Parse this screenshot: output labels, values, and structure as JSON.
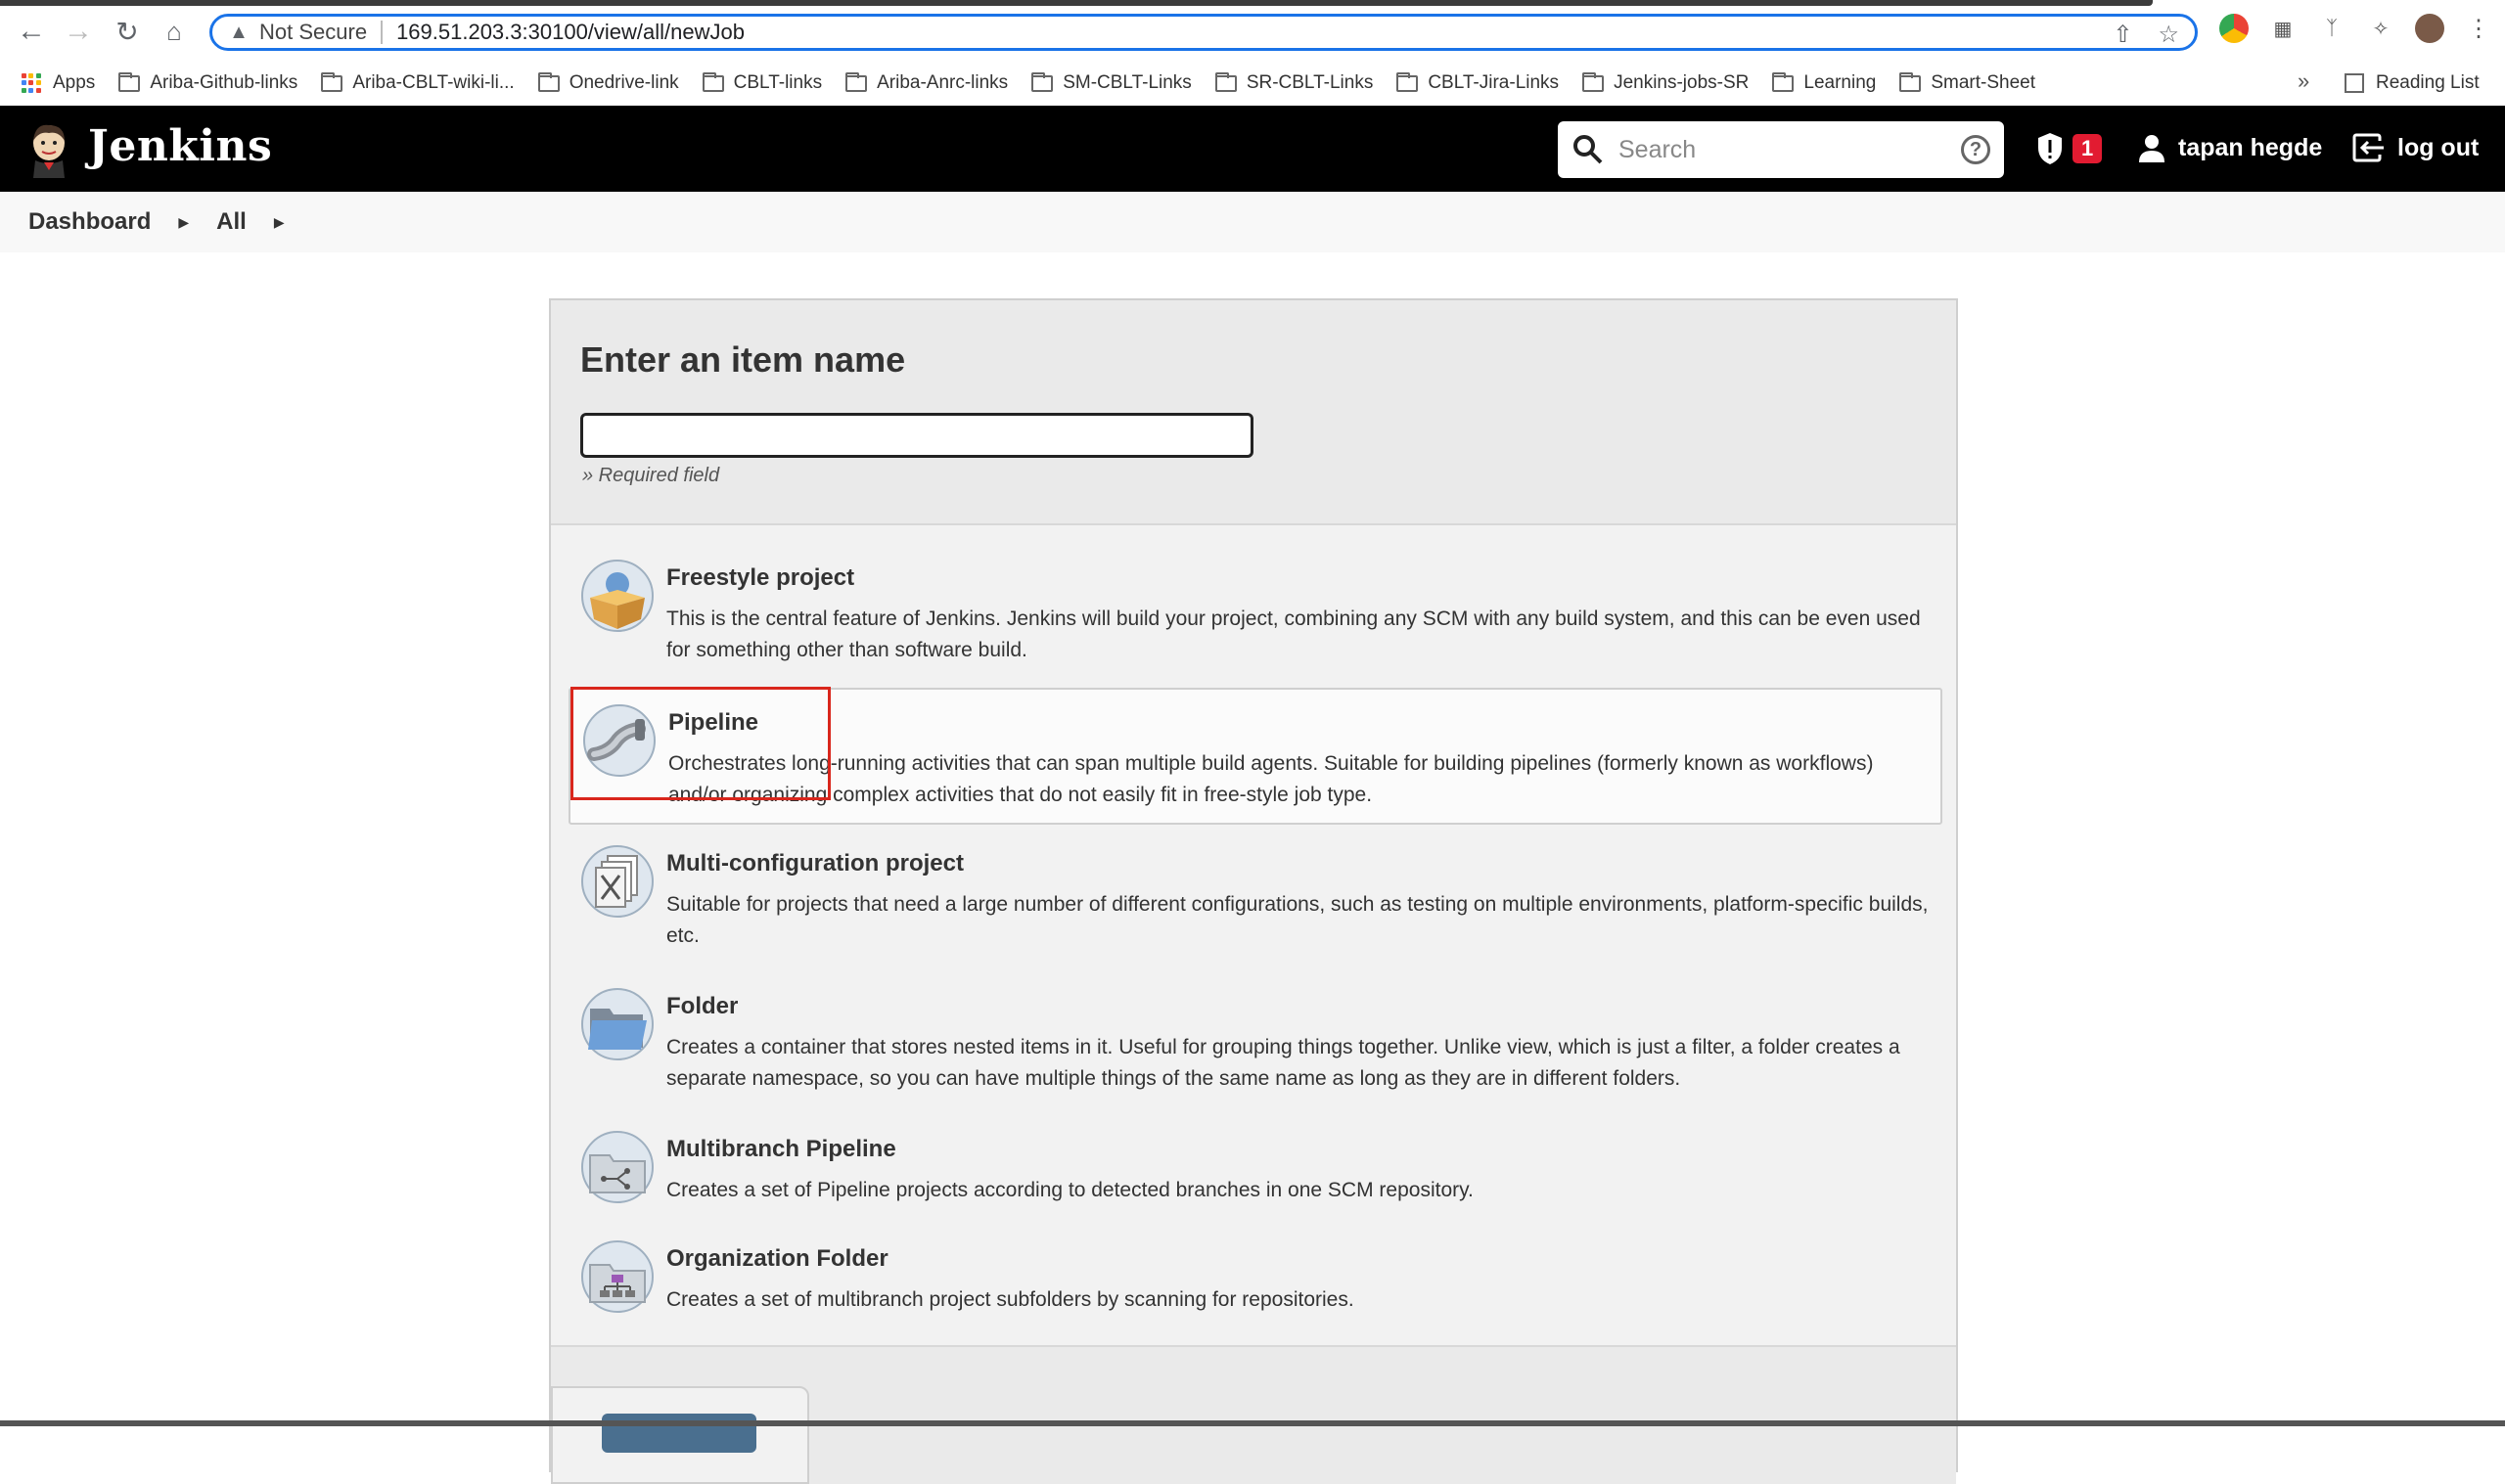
{
  "browser": {
    "security_label": "Not Secure",
    "url": "169.51.203.3:30100/view/all/newJob",
    "bookmarks": [
      {
        "label": "Apps",
        "type": "apps"
      },
      {
        "label": "Ariba-Github-links",
        "type": "folder"
      },
      {
        "label": "Ariba-CBLT-wiki-li...",
        "type": "folder"
      },
      {
        "label": "Onedrive-link",
        "type": "folder"
      },
      {
        "label": "CBLT-links",
        "type": "folder"
      },
      {
        "label": "Ariba-Anrc-links",
        "type": "folder"
      },
      {
        "label": "SM-CBLT-Links",
        "type": "folder"
      },
      {
        "label": "SR-CBLT-Links",
        "type": "folder"
      },
      {
        "label": "CBLT-Jira-Links",
        "type": "folder"
      },
      {
        "label": "Jenkins-jobs-SR",
        "type": "folder"
      },
      {
        "label": "Learning",
        "type": "folder"
      },
      {
        "label": "Smart-Sheet",
        "type": "folder"
      }
    ],
    "more_label": "»",
    "reading_list_label": "Reading List"
  },
  "header": {
    "title": "Jenkins",
    "search_placeholder": "Search",
    "alert_count": "1",
    "user_name": "tapan hegde",
    "logout_label": "log out"
  },
  "breadcrumb": {
    "items": [
      "Dashboard",
      "All"
    ]
  },
  "form": {
    "heading": "Enter an item name",
    "name_value": "",
    "required_note": "» Required field"
  },
  "item_types": [
    {
      "label": "Freestyle project",
      "icon": "freestyle-box-icon",
      "desc": "This is the central feature of Jenkins. Jenkins will build your project, combining any SCM with any build system, and this can be even used for something other than software build."
    },
    {
      "label": "Pipeline",
      "icon": "pipeline-pipe-icon",
      "desc": "Orchestrates long-running activities that can span multiple build agents. Suitable for building pipelines (formerly known as workflows) and/or organizing complex activities that do not easily fit in free-style job type."
    },
    {
      "label": "Multi-configuration project",
      "icon": "multi-config-icon",
      "desc": "Suitable for projects that need a large number of different configurations, such as testing on multiple environments, platform-specific builds, etc."
    },
    {
      "label": "Folder",
      "icon": "folder-icon",
      "desc": "Creates a container that stores nested items in it. Useful for grouping things together. Unlike view, which is just a filter, a folder creates a separate namespace, so you can have multiple things of the same name as long as they are in different folders."
    },
    {
      "label": "Multibranch Pipeline",
      "icon": "multibranch-icon",
      "desc": "Creates a set of Pipeline projects according to detected branches in one SCM repository."
    },
    {
      "label": "Organization Folder",
      "icon": "org-folder-icon",
      "desc": "Creates a set of multibranch project subfolders by scanning for repositories."
    }
  ],
  "colors": {
    "header_bg": "#000000",
    "accent": "#1a73e8",
    "alert_badge": "#e21b31",
    "highlight_box": "#d9261c"
  }
}
